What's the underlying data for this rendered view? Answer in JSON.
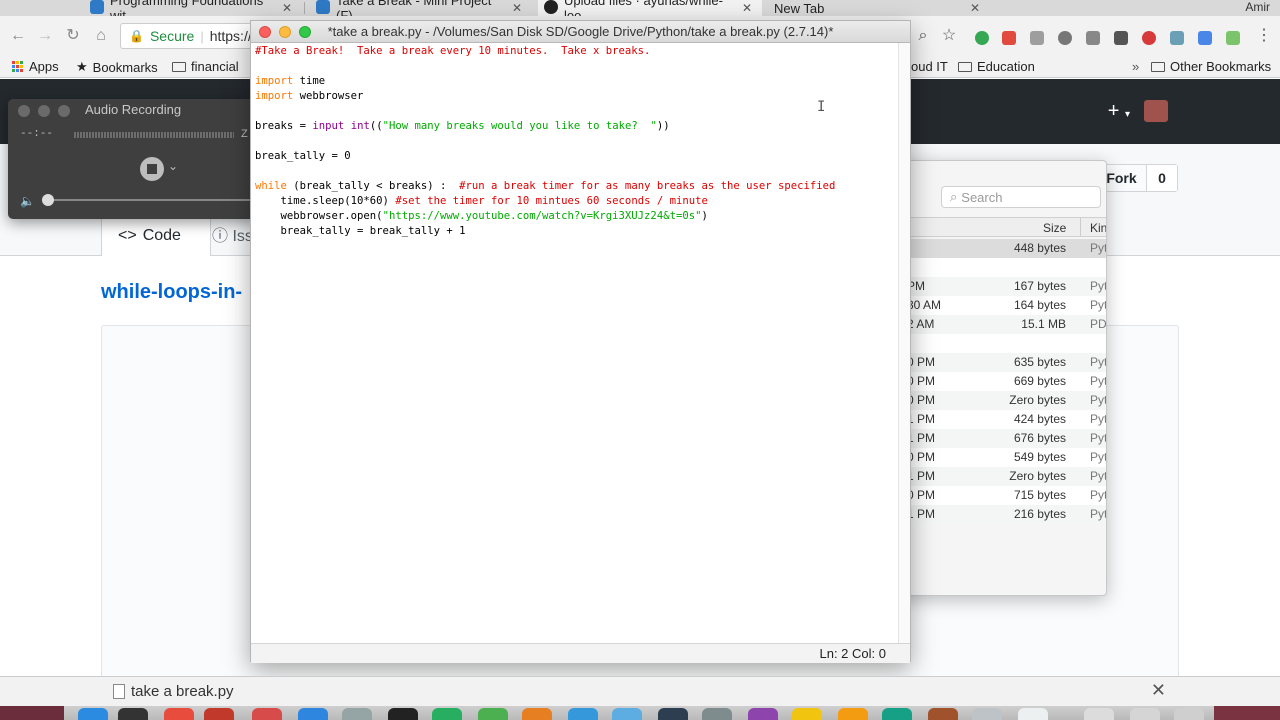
{
  "browser": {
    "tabs": [
      {
        "title": "Programming Foundations wit",
        "favicon_color": "#2f7ac6"
      },
      {
        "title": "Take a Break - Mini Project (F)",
        "favicon_color": "#2f7ac6"
      },
      {
        "title": "Upload files · ayunas/while-loo",
        "favicon_color": "#222222"
      },
      {
        "title": "New Tab",
        "favicon_color": ""
      }
    ],
    "user_name": "Amir",
    "omnibox": {
      "secure_label": "Secure",
      "url": "https://"
    },
    "bookmarks": [
      {
        "label": "Apps"
      },
      {
        "label": "Bookmarks"
      },
      {
        "label": "financial"
      },
      {
        "label": "oud IT"
      },
      {
        "label": "Education"
      },
      {
        "label": "Other Bookmarks"
      }
    ],
    "bookmarks_overflow": "»"
  },
  "github": {
    "plus_label": "+",
    "fork_label": "Fork",
    "fork_count": "0",
    "code_tab": "Code",
    "code_icon": "<>",
    "issues_tab": "Iss",
    "repo_title": "while-loops-in-"
  },
  "audio_recording": {
    "title": "Audio Recording",
    "time": "--:--",
    "meter_end": "Z"
  },
  "finder": {
    "search_placeholder": "Search",
    "columns": {
      "size": "Size",
      "kind": "Kin"
    },
    "rows": [
      {
        "date": "",
        "size": "448 bytes",
        "kind": "Pyt",
        "selected": true
      },
      {
        "date": "",
        "size": "",
        "kind": ""
      },
      {
        "date": "PM",
        "size": "167 bytes",
        "kind": "Pyt"
      },
      {
        "date": "30 AM",
        "size": "164 bytes",
        "kind": "Pyt"
      },
      {
        "date": "2 AM",
        "size": "15.1 MB",
        "kind": "PD"
      },
      {
        "date": "",
        "size": "",
        "kind": ""
      },
      {
        "date": "0 PM",
        "size": "635 bytes",
        "kind": "Pyt"
      },
      {
        "date": "0 PM",
        "size": "669 bytes",
        "kind": "Pyt"
      },
      {
        "date": "0 PM",
        "size": "Zero bytes",
        "kind": "Pyt"
      },
      {
        "date": "1 PM",
        "size": "424 bytes",
        "kind": "Pyt"
      },
      {
        "date": "1 PM",
        "size": "676 bytes",
        "kind": "Pyt"
      },
      {
        "date": "0 PM",
        "size": "549 bytes",
        "kind": "Pyt"
      },
      {
        "date": "1 PM",
        "size": "Zero bytes",
        "kind": "Pyt"
      },
      {
        "date": "0 PM",
        "size": "715 bytes",
        "kind": "Pyt"
      },
      {
        "date": "1 PM",
        "size": "216 bytes",
        "kind": "Pyt"
      }
    ]
  },
  "editor": {
    "title": "*take a break.py - /Volumes/San Disk SD/Google Drive/Python/take a break.py (2.7.14)*",
    "status": "Ln: 2   Col: 0",
    "code_lines": [
      [
        {
          "t": "#Take a Break!  Take a break every 10 minutes.  Take x breaks.",
          "c": "comment"
        }
      ],
      [],
      [
        {
          "t": "import",
          "c": "kw"
        },
        {
          "t": " time",
          "c": ""
        }
      ],
      [
        {
          "t": "import",
          "c": "kw"
        },
        {
          "t": " webbrowser",
          "c": ""
        }
      ],
      [],
      [
        {
          "t": "breaks = ",
          "c": ""
        },
        {
          "t": "input",
          "c": "builtin"
        },
        {
          "t": " ",
          "c": ""
        },
        {
          "t": "int",
          "c": "builtin"
        },
        {
          "t": "((",
          "c": ""
        },
        {
          "t": "\"How many breaks would you like to take?  \"",
          "c": "str"
        },
        {
          "t": "))",
          "c": ""
        }
      ],
      [],
      [
        {
          "t": "break_tally = 0",
          "c": ""
        }
      ],
      [],
      [
        {
          "t": "while",
          "c": "kw"
        },
        {
          "t": " (break_tally < breaks) :  ",
          "c": ""
        },
        {
          "t": "#run a break timer for as many breaks as the user specified",
          "c": "comment"
        }
      ],
      [
        {
          "t": "    time.sleep(10*60) ",
          "c": ""
        },
        {
          "t": "#set the timer for 10 mintues 60 seconds / minute",
          "c": "comment"
        }
      ],
      [
        {
          "t": "    webbrowser.open(",
          "c": ""
        },
        {
          "t": "\"https://www.youtube.com/watch?v=Krgi3XUJz24&t=0s\"",
          "c": "str"
        },
        {
          "t": ")",
          "c": ""
        }
      ],
      [
        {
          "t": "    break_tally = break_tally + 1",
          "c": ""
        }
      ]
    ]
  },
  "download_bar": {
    "file_name": "take a break.py",
    "close_label": "✕"
  },
  "colors": {
    "github_header": "#24292e",
    "link_blue": "#0366d6",
    "idle_comment": "#dd0000",
    "idle_keyword": "#ff7700",
    "idle_builtin": "#900090",
    "idle_string": "#00aa00"
  }
}
